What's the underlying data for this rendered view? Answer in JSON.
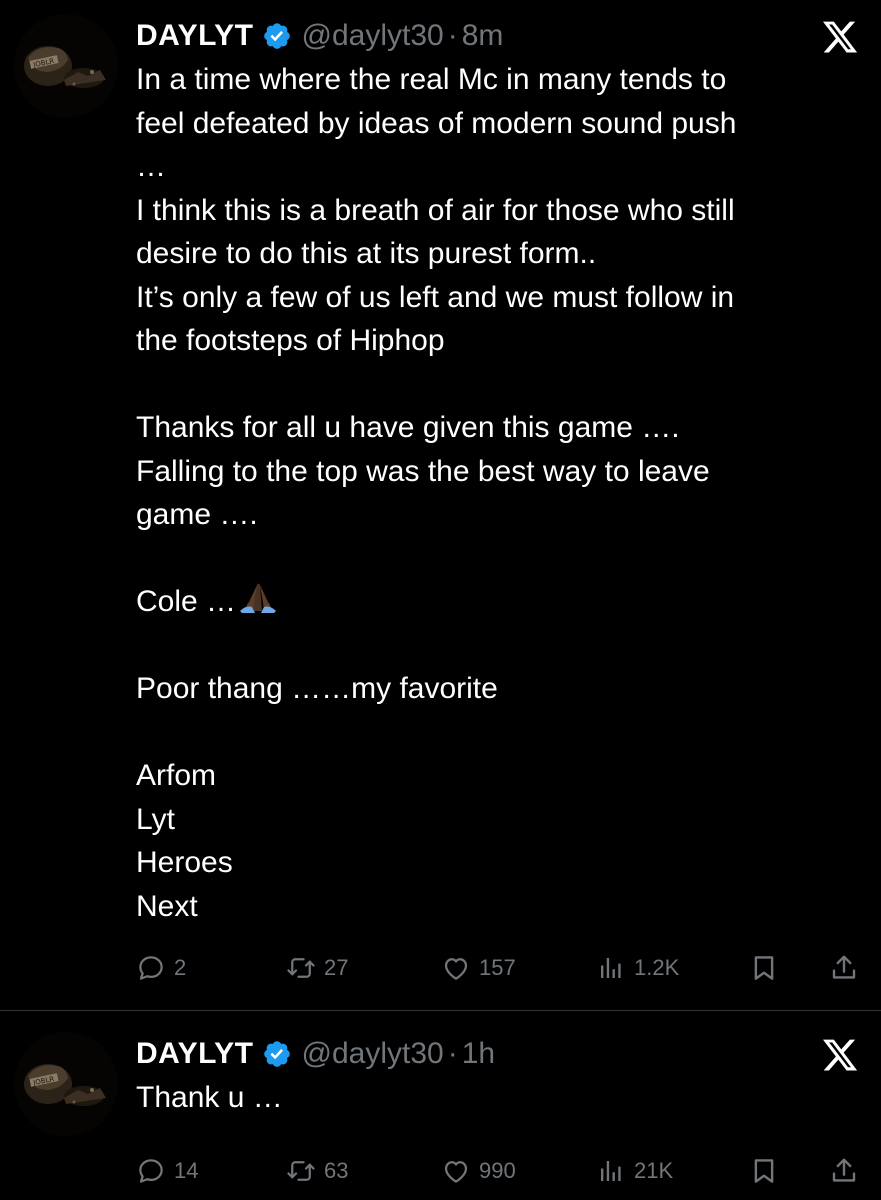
{
  "colors": {
    "background": "#000000",
    "text_primary": "#ffffff",
    "text_secondary": "#71767b",
    "verified_badge": "#1d9bf0",
    "divider": "#2f3336"
  },
  "tweets": [
    {
      "author": {
        "name": "DAYLYT",
        "handle": "@daylyt30",
        "verified_icon": "verified-badge-icon",
        "avatar_icon": "avatar-image"
      },
      "separator": "·",
      "time": "8m",
      "platform_icon": "x-logo-icon",
      "lines": [
        "In a time where the real Mc in many tends to",
        "feel defeated by ideas of modern  sound  push",
        "…",
        "I think this is a breath of air for those who still",
        "desire to do this at its purest form..",
        "It’s only a few of us left and we must follow in",
        "the footsteps of Hiphop",
        "",
        "Thanks for all u have given this game ….",
        "Falling to the top was the best way to leave",
        "game ….",
        "",
        "Cole …",
        "",
        "Poor thang ……my favorite",
        "",
        "Arfom",
        "Lyt",
        "Heroes",
        "Next"
      ],
      "emoji_icon": "folded-hands-icon",
      "stats": {
        "replies": "2",
        "retweets": "27",
        "likes": "157",
        "views": "1.2K"
      }
    },
    {
      "author": {
        "name": "DAYLYT",
        "handle": "@daylyt30",
        "verified_icon": "verified-badge-icon",
        "avatar_icon": "avatar-image"
      },
      "separator": "·",
      "time": "1h",
      "platform_icon": "x-logo-icon",
      "lines": [
        "Thank u …"
      ],
      "stats": {
        "replies": "14",
        "retweets": "63",
        "likes": "990",
        "views": "21K"
      }
    }
  ]
}
